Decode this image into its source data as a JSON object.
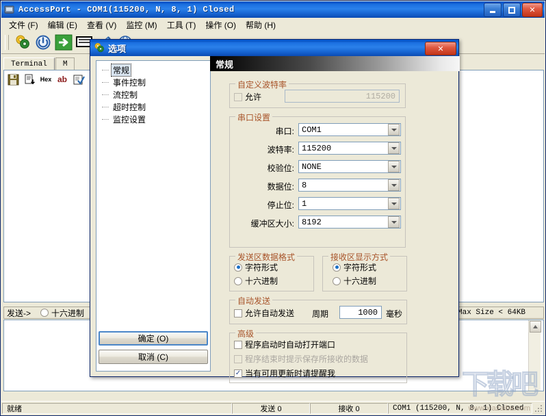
{
  "window": {
    "title": "AccessPort - COM1(115200, N, 8, 1) Closed",
    "icon": "app-icon",
    "minimize": "–",
    "maximize": "□",
    "close": "✕"
  },
  "menu": {
    "items": [
      {
        "label": "文件 (F)"
      },
      {
        "label": "编辑 (E)"
      },
      {
        "label": "查看 (V)"
      },
      {
        "label": "监控 (M)"
      },
      {
        "label": "工具 (T)"
      },
      {
        "label": "操作 (O)"
      },
      {
        "label": "帮助 (H)"
      }
    ]
  },
  "toolbar": {
    "buttons": [
      {
        "name": "settings-gears-icon"
      },
      {
        "name": "power-icon"
      },
      {
        "name": "green-arrow-icon"
      },
      {
        "name": "terminal-icon"
      },
      {
        "name": "pencil-icon"
      },
      {
        "name": "globe-icon"
      }
    ]
  },
  "terminal": {
    "tabs": [
      {
        "label": "Terminal",
        "active": true
      },
      {
        "label": "M",
        "active": false
      }
    ],
    "mini_tools": [
      {
        "name": "save-icon",
        "glyph": "💾"
      },
      {
        "name": "export-icon",
        "glyph": "⤓"
      },
      {
        "name": "hex-icon",
        "glyph": "Hex"
      },
      {
        "name": "ab-icon",
        "glyph": "ab"
      },
      {
        "name": "clear-icon",
        "glyph": "✔"
      }
    ],
    "send_label": "发送->",
    "send_hex_label": "十六进制",
    "max_size_label": "Max Size < 64KB"
  },
  "statusbar": {
    "ready": "就绪",
    "sent": "发送  0",
    "received": "接收  0",
    "port": "COM1 (115200, N, 8, 1) Closed"
  },
  "watermark": {
    "big": "下载吧",
    "small": "www.xiazaiba.com"
  },
  "dialog": {
    "title": "选项",
    "close": "✕",
    "tree": [
      {
        "label": "常规",
        "selected": true
      },
      {
        "label": "事件控制",
        "selected": false
      },
      {
        "label": "流控制",
        "selected": false
      },
      {
        "label": "超时控制",
        "selected": false
      },
      {
        "label": "监控设置",
        "selected": false
      }
    ],
    "banner": "常规",
    "custom_baud": {
      "title": "自定义波特率",
      "enable_label": "允许",
      "enable_checked": false,
      "value": "115200",
      "value_enabled": false
    },
    "serial": {
      "title": "串口设置",
      "fields": [
        {
          "label": "串口:",
          "value": "COM1"
        },
        {
          "label": "波特率:",
          "value": "115200"
        },
        {
          "label": "校验位:",
          "value": "NONE"
        },
        {
          "label": "数据位:",
          "value": "8"
        },
        {
          "label": "停止位:",
          "value": "1"
        },
        {
          "label": "缓冲区大小:",
          "value": "8192"
        }
      ]
    },
    "send_format": {
      "title": "发送区数据格式",
      "options": [
        {
          "label": "字符形式",
          "selected": true
        },
        {
          "label": "十六进制",
          "selected": false
        }
      ]
    },
    "recv_format": {
      "title": "接收区显示方式",
      "options": [
        {
          "label": "字符形式",
          "selected": true
        },
        {
          "label": "十六进制",
          "selected": false
        }
      ]
    },
    "auto_send": {
      "title": "自动发送",
      "enable_label": "允许自动发送",
      "enable_checked": false,
      "period_label": "周期",
      "period_value": "1000",
      "unit_label": "毫秒"
    },
    "advanced": {
      "title": "高级",
      "options": [
        {
          "label": "程序启动时自动打开端口",
          "checked": false,
          "disabled": false
        },
        {
          "label": "程序结束时提示保存所接收的数据",
          "checked": false,
          "disabled": true
        },
        {
          "label": "当有可用更新时请提醒我",
          "checked": true,
          "disabled": false
        }
      ]
    },
    "ok_label": "确定 (O)",
    "cancel_label": "取消 (C)"
  }
}
